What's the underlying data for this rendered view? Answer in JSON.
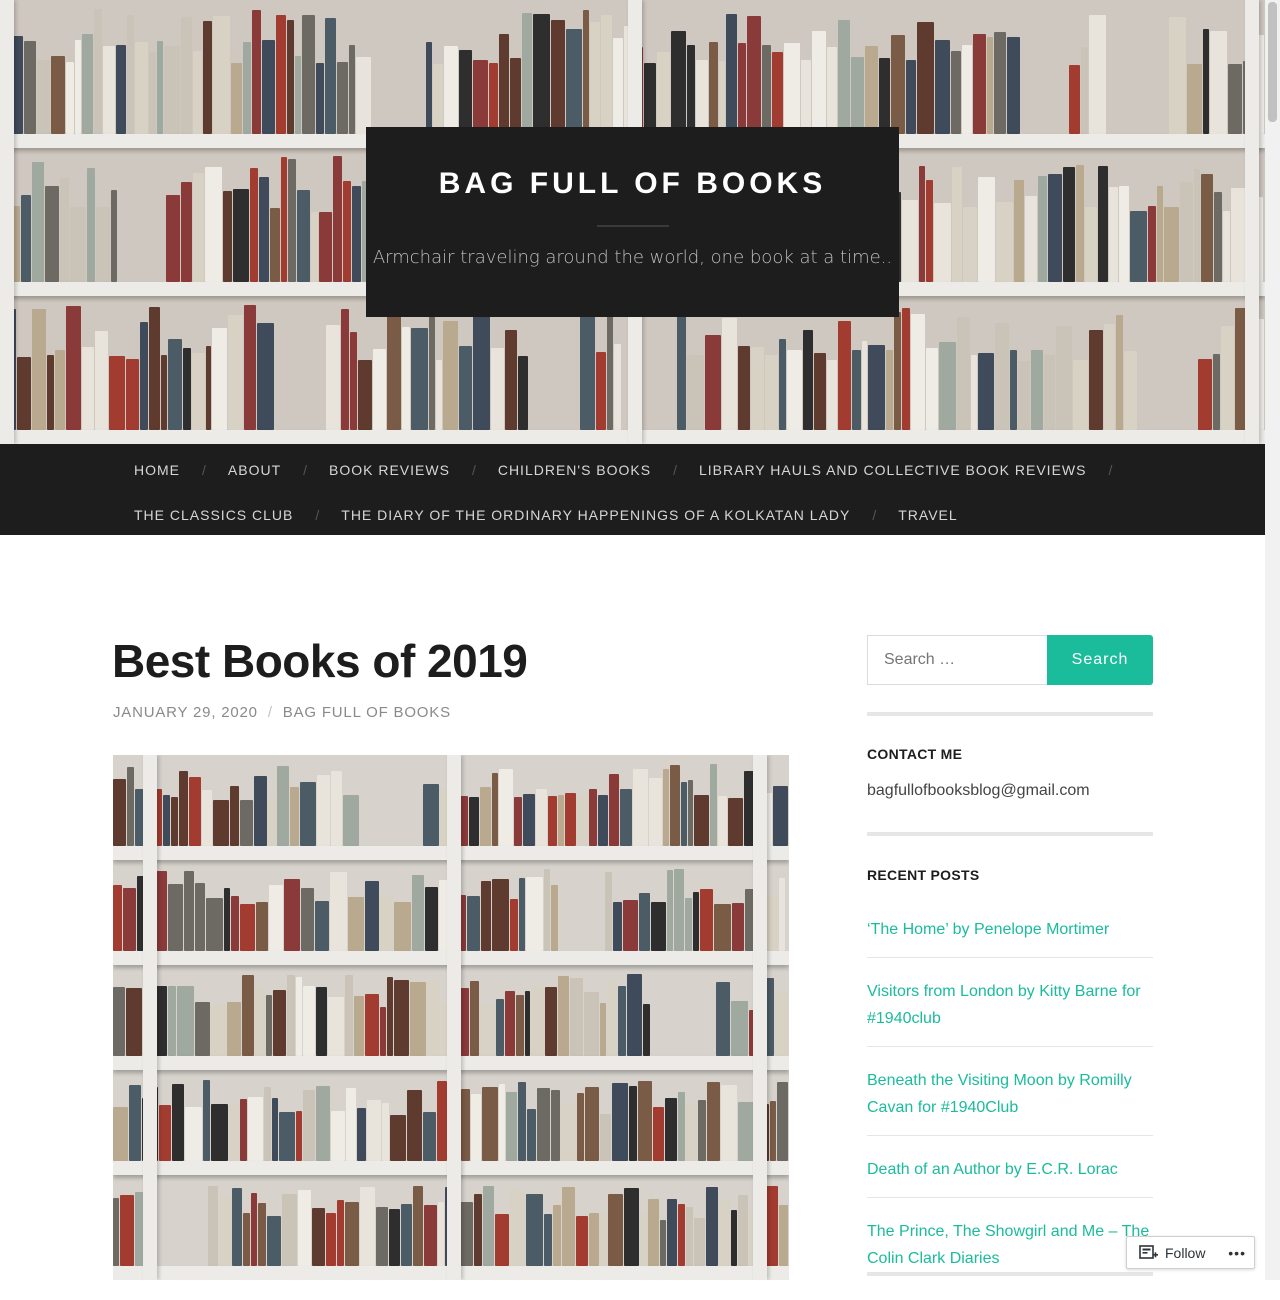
{
  "site": {
    "title": "BAG FULL OF BOOKS",
    "description": "Armchair traveling around the world, one book at a time.."
  },
  "nav": {
    "items": [
      "HOME",
      "ABOUT",
      "BOOK REVIEWS",
      "CHILDREN'S BOOKS",
      "LIBRARY HAULS AND COLLECTIVE BOOK REVIEWS",
      "THE CLASSICS CLUB",
      "THE DIARY OF THE ORDINARY HAPPENINGS OF A KOLKATAN LADY",
      "TRAVEL"
    ],
    "separator": "/"
  },
  "post": {
    "title": "Best Books of 2019",
    "date": "JANUARY 29, 2020",
    "author": "BAG FULL OF BOOKS",
    "meta_separator": "/"
  },
  "sidebar": {
    "search": {
      "placeholder": "Search …",
      "button": "Search"
    },
    "contact": {
      "title": "CONTACT ME",
      "email": "bagfullofbooksblog@gmail.com"
    },
    "recent": {
      "title": "RECENT POSTS",
      "posts": [
        "‘The Home’ by Penelope Mortimer",
        "Visitors from London by Kitty Barne for #1940club",
        "Beneath the Visiting Moon by Romilly Cavan for #1940Club",
        "Death of an Author by E.C.R. Lorac",
        "The Prince, The Showgirl and Me – The Colin Clark Diaries"
      ]
    }
  },
  "follow": {
    "label": "Follow",
    "more": "•••"
  },
  "colors": {
    "accent": "#1abc9c",
    "dark": "#1d1d1d"
  }
}
